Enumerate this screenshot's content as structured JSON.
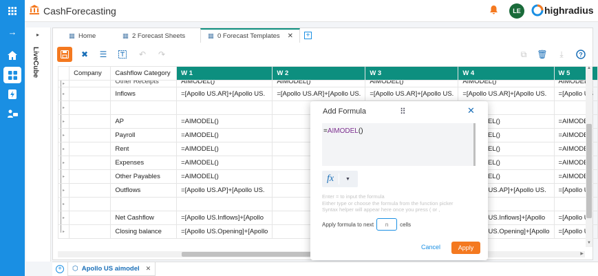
{
  "app": {
    "name": "CashForecasting",
    "user_initials": "LE",
    "brand": "highradius",
    "side_label": "LiveCube"
  },
  "tabs": [
    {
      "label": "Home"
    },
    {
      "label": "2 Forecast Sheets"
    },
    {
      "label": "0 Forecast Templates",
      "active": true
    }
  ],
  "grid": {
    "headers": [
      "Company",
      "Cashflow Category",
      "W 1",
      "W 2",
      "W 3",
      "W 4",
      "W 5"
    ],
    "partial_row": [
      "",
      "Other Receipts",
      "AIMODEL()",
      "AIMODEL()",
      "AIMODEL()",
      "AIMODEL()",
      "AIMODEL()"
    ],
    "rows": [
      {
        "cat": "Inflows",
        "bold": true,
        "w1": "=[Apollo US.AR]+[Apollo US.",
        "w2": "=[Apollo US.AR]+[Apollo US.",
        "w3": "=[Apollo US.AR]+[Apollo US.",
        "w4": "=[Apollo US.AR]+[Apollo US.",
        "w5": "=[Apollo US"
      },
      {
        "cat": "",
        "bold": false,
        "w1": "",
        "w2": "",
        "w3": "",
        "w4": "",
        "w5": ""
      },
      {
        "cat": "AP",
        "bold": false,
        "w1": "=AIMODEL()",
        "w2": "",
        "w3": "",
        "w4": "=AIMODEL()",
        "w5": "=AIMODEL"
      },
      {
        "cat": "Payroll",
        "bold": false,
        "w1": "=AIMODEL()",
        "w2": "",
        "w3": "",
        "w4": "=AIMODEL()",
        "w5": "=AIMODEL"
      },
      {
        "cat": "Rent",
        "bold": false,
        "w1": "=AIMODEL()",
        "w2": "",
        "w3": "",
        "w4": "=AIMODEL()",
        "w5": "=AIMODEL"
      },
      {
        "cat": "Expenses",
        "bold": false,
        "w1": "=AIMODEL()",
        "w2": "",
        "w3": "",
        "w4": "=AIMODEL()",
        "w5": "=AIMODEL"
      },
      {
        "cat": "Other Payables",
        "bold": false,
        "w1": "=AIMODEL()",
        "w2": "",
        "w3": "",
        "w4": "=AIMODEL()",
        "w5": "=AIMODEL"
      },
      {
        "cat": "Outflows",
        "bold": true,
        "w1": "=[Apollo US.AP]+[Apollo US.",
        "w2": "",
        "w3": "",
        "w4": "=[Apollo US.AP]+[Apollo US.",
        "w5": "=[Apollo U"
      },
      {
        "cat": "",
        "bold": false,
        "w1": "",
        "w2": "",
        "w3": "",
        "w4": "",
        "w5": ""
      },
      {
        "cat": "Net Cashflow",
        "bold": true,
        "w1": "=[Apollo US.Inflows]+[Apollo",
        "w2": "",
        "w3": "",
        "w4": "=[Apollo US.Inflows]+[Apollo",
        "w5": "=[Apollo U"
      },
      {
        "cat": "Closing balance",
        "bold": true,
        "w1": "=[Apollo US.Opening]+[Apollo",
        "w2": "",
        "w3": "",
        "w4": "=[Apollo US.Opening]+[Apollo",
        "w5": "=[Apollo U"
      }
    ]
  },
  "modal": {
    "title": "Add Formula",
    "formula_prefix": "=",
    "formula_name": "AIMODEL",
    "formula_args": "()",
    "fx_label": "fx",
    "help_1": "Enter = to input the formula",
    "help_2": "Either type or choose the formula from the function picker",
    "help_3": "Syntax helper will appear here once you press ( or ,",
    "apply_next_label": "Apply formula to next",
    "n_placeholder": "n",
    "cells_label": "cells",
    "cancel": "Cancel",
    "apply": "Apply"
  },
  "bottom_tab": {
    "label": "Apollo US aimodel"
  },
  "colors": {
    "accent": "#f47920",
    "blue": "#1a8fe3",
    "teal": "#0d8f7f",
    "purple": "#7b2d8e"
  }
}
